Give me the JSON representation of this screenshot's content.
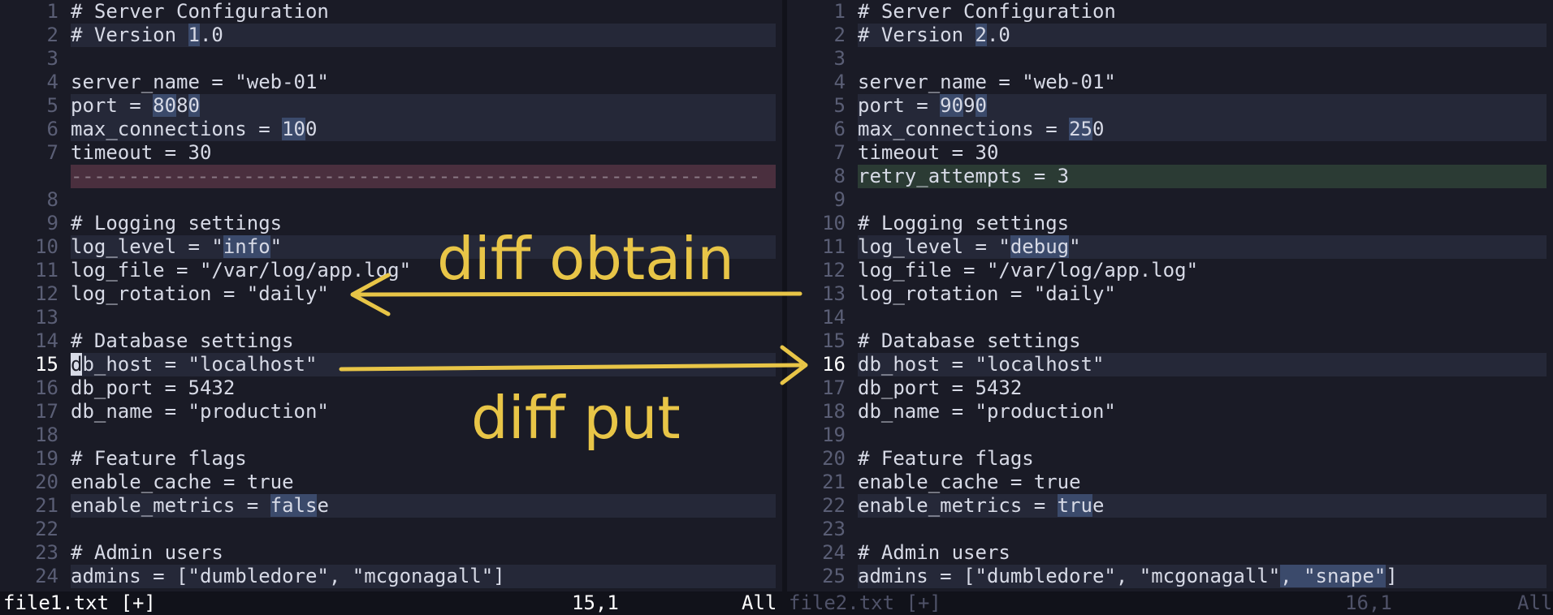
{
  "left": {
    "lines": [
      {
        "num": "1",
        "segs": [
          {
            "t": "# Server Configuration"
          }
        ]
      },
      {
        "num": "2",
        "state": "changed",
        "segs": [
          {
            "t": "# Version "
          },
          {
            "t": "1",
            "hl": true
          },
          {
            "t": ".0"
          }
        ]
      },
      {
        "num": "3",
        "segs": [
          {
            "t": ""
          }
        ]
      },
      {
        "num": "4",
        "segs": [
          {
            "t": "server_name = \"web-01\""
          }
        ]
      },
      {
        "num": "5",
        "state": "changed",
        "segs": [
          {
            "t": "port = "
          },
          {
            "t": "80",
            "hl": true
          },
          {
            "t": "8"
          },
          {
            "t": "0",
            "hl": true
          }
        ]
      },
      {
        "num": "6",
        "state": "changed",
        "segs": [
          {
            "t": "max_connections = "
          },
          {
            "t": "10",
            "hl": true
          },
          {
            "t": "0"
          }
        ]
      },
      {
        "num": "7",
        "segs": [
          {
            "t": "timeout = 30"
          }
        ]
      },
      {
        "num": "",
        "state": "deleted",
        "segs": [
          {
            "t": "------------------------------------------------------------"
          }
        ]
      },
      {
        "num": "8",
        "segs": [
          {
            "t": ""
          }
        ]
      },
      {
        "num": "9",
        "segs": [
          {
            "t": "# Logging settings"
          }
        ]
      },
      {
        "num": "10",
        "state": "changed",
        "segs": [
          {
            "t": "log_level = \""
          },
          {
            "t": "info",
            "hl": true
          },
          {
            "t": "\""
          }
        ]
      },
      {
        "num": "11",
        "segs": [
          {
            "t": "log_file = \"/var/log/app.log\""
          }
        ]
      },
      {
        "num": "12",
        "segs": [
          {
            "t": "log_rotation = \"daily\""
          }
        ]
      },
      {
        "num": "13",
        "segs": [
          {
            "t": ""
          }
        ]
      },
      {
        "num": "14",
        "segs": [
          {
            "t": "# Database settings"
          }
        ]
      },
      {
        "num": "15",
        "current": true,
        "state": "changed",
        "segs": [
          {
            "t": "d",
            "cursor": true
          },
          {
            "t": "b_host = \"localhost\""
          }
        ]
      },
      {
        "num": "16",
        "segs": [
          {
            "t": "db_port = 5432"
          }
        ]
      },
      {
        "num": "17",
        "segs": [
          {
            "t": "db_name = \"production\""
          }
        ]
      },
      {
        "num": "18",
        "segs": [
          {
            "t": ""
          }
        ]
      },
      {
        "num": "19",
        "segs": [
          {
            "t": "# Feature flags"
          }
        ]
      },
      {
        "num": "20",
        "segs": [
          {
            "t": "enable_cache = true"
          }
        ]
      },
      {
        "num": "21",
        "state": "changed",
        "segs": [
          {
            "t": "enable_metrics = "
          },
          {
            "t": "fals",
            "hl": true
          },
          {
            "t": "e"
          }
        ]
      },
      {
        "num": "22",
        "segs": [
          {
            "t": ""
          }
        ]
      },
      {
        "num": "23",
        "segs": [
          {
            "t": "# Admin users"
          }
        ]
      },
      {
        "num": "24",
        "state": "changed",
        "segs": [
          {
            "t": "admins = [\"dumbledore\", \"mcgonagall\"]"
          }
        ]
      }
    ],
    "status": {
      "file": "file1.txt [+]",
      "pos": "15,1",
      "pct": "All"
    }
  },
  "right": {
    "lines": [
      {
        "num": "1",
        "segs": [
          {
            "t": "# Server Configuration"
          }
        ]
      },
      {
        "num": "2",
        "state": "changed",
        "segs": [
          {
            "t": "# Version "
          },
          {
            "t": "2",
            "hl": true
          },
          {
            "t": ".0"
          }
        ]
      },
      {
        "num": "3",
        "segs": [
          {
            "t": ""
          }
        ]
      },
      {
        "num": "4",
        "segs": [
          {
            "t": "server_name = \"web-01\""
          }
        ]
      },
      {
        "num": "5",
        "state": "changed",
        "segs": [
          {
            "t": "port = "
          },
          {
            "t": "90",
            "hl": true
          },
          {
            "t": "9"
          },
          {
            "t": "0",
            "hl": true
          }
        ]
      },
      {
        "num": "6",
        "state": "changed",
        "segs": [
          {
            "t": "max_connections = "
          },
          {
            "t": "25",
            "hl": true
          },
          {
            "t": "0"
          }
        ]
      },
      {
        "num": "7",
        "segs": [
          {
            "t": "timeout = 30"
          }
        ]
      },
      {
        "num": "8",
        "state": "added",
        "segs": [
          {
            "t": "retry_attempts = 3"
          }
        ]
      },
      {
        "num": "9",
        "segs": [
          {
            "t": ""
          }
        ]
      },
      {
        "num": "10",
        "segs": [
          {
            "t": "# Logging settings"
          }
        ]
      },
      {
        "num": "11",
        "state": "changed",
        "segs": [
          {
            "t": "log_level = \""
          },
          {
            "t": "debug",
            "hl": true
          },
          {
            "t": "\""
          }
        ]
      },
      {
        "num": "12",
        "segs": [
          {
            "t": "log_file = \"/var/log/app.log\""
          }
        ]
      },
      {
        "num": "13",
        "segs": [
          {
            "t": "log_rotation = \"daily\""
          }
        ]
      },
      {
        "num": "14",
        "segs": [
          {
            "t": ""
          }
        ]
      },
      {
        "num": "15",
        "segs": [
          {
            "t": "# Database settings"
          }
        ]
      },
      {
        "num": "16",
        "current": true,
        "state": "changed",
        "segs": [
          {
            "t": "db_host = \"localhost\""
          }
        ]
      },
      {
        "num": "17",
        "segs": [
          {
            "t": "db_port = 5432"
          }
        ]
      },
      {
        "num": "18",
        "segs": [
          {
            "t": "db_name = \"production\""
          }
        ]
      },
      {
        "num": "19",
        "segs": [
          {
            "t": ""
          }
        ]
      },
      {
        "num": "20",
        "segs": [
          {
            "t": "# Feature flags"
          }
        ]
      },
      {
        "num": "21",
        "segs": [
          {
            "t": "enable_cache = true"
          }
        ]
      },
      {
        "num": "22",
        "state": "changed",
        "segs": [
          {
            "t": "enable_metrics = "
          },
          {
            "t": "tru",
            "hl": true
          },
          {
            "t": "e"
          }
        ]
      },
      {
        "num": "23",
        "segs": [
          {
            "t": ""
          }
        ]
      },
      {
        "num": "24",
        "segs": [
          {
            "t": "# Admin users"
          }
        ]
      },
      {
        "num": "25",
        "state": "changed",
        "segs": [
          {
            "t": "admins = [\"dumbledore\", \"mcgonagall\""
          },
          {
            "t": ", \"snape\"",
            "hl": true
          },
          {
            "t": "]"
          }
        ]
      }
    ],
    "status": {
      "file": "file2.txt [+]",
      "pos": "16,1",
      "pct": "All"
    }
  },
  "annotations": {
    "obtain_label": "diff obtain",
    "put_label": "diff put",
    "color": "#e8c547"
  },
  "colors": {
    "background": "#1a1b26",
    "changed_line": "#252838",
    "changed_text": "#3b4a6b",
    "added_line": "#2b3b34",
    "deleted_line": "#4a2f3e"
  }
}
